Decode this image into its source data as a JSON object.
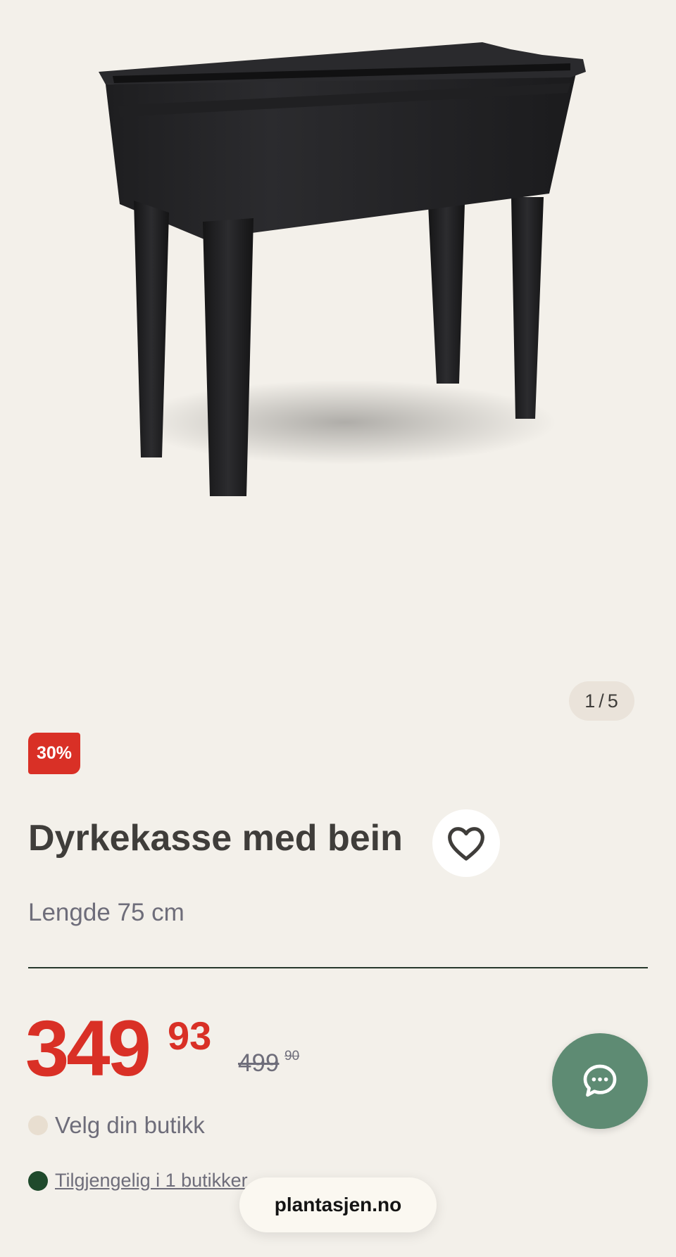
{
  "gallery": {
    "image_alt": "Dyrkekasse med bein",
    "counter_current": "1",
    "counter_separator": "/",
    "counter_total": "5"
  },
  "product": {
    "discount_badge": "30%",
    "title": "Dyrkekasse med bein",
    "subtitle": "Lengde 75 cm"
  },
  "price": {
    "current_main": "349",
    "current_cents": "93",
    "old_main": "499",
    "old_cents": "90",
    "accent_color": "#d93026"
  },
  "store": {
    "select_label": "Velg din butikk",
    "availability_label": "Tilgjengelig i 1 butikker"
  },
  "browser": {
    "url": "plantasjen.no"
  },
  "icons": {
    "favorite": "heart-icon",
    "chat": "chat-bubble-icon"
  },
  "colors": {
    "background": "#f3f0ea",
    "chat_button": "#5e8b73",
    "available_dot": "#1f4a2c",
    "badge_red": "#d93026"
  }
}
